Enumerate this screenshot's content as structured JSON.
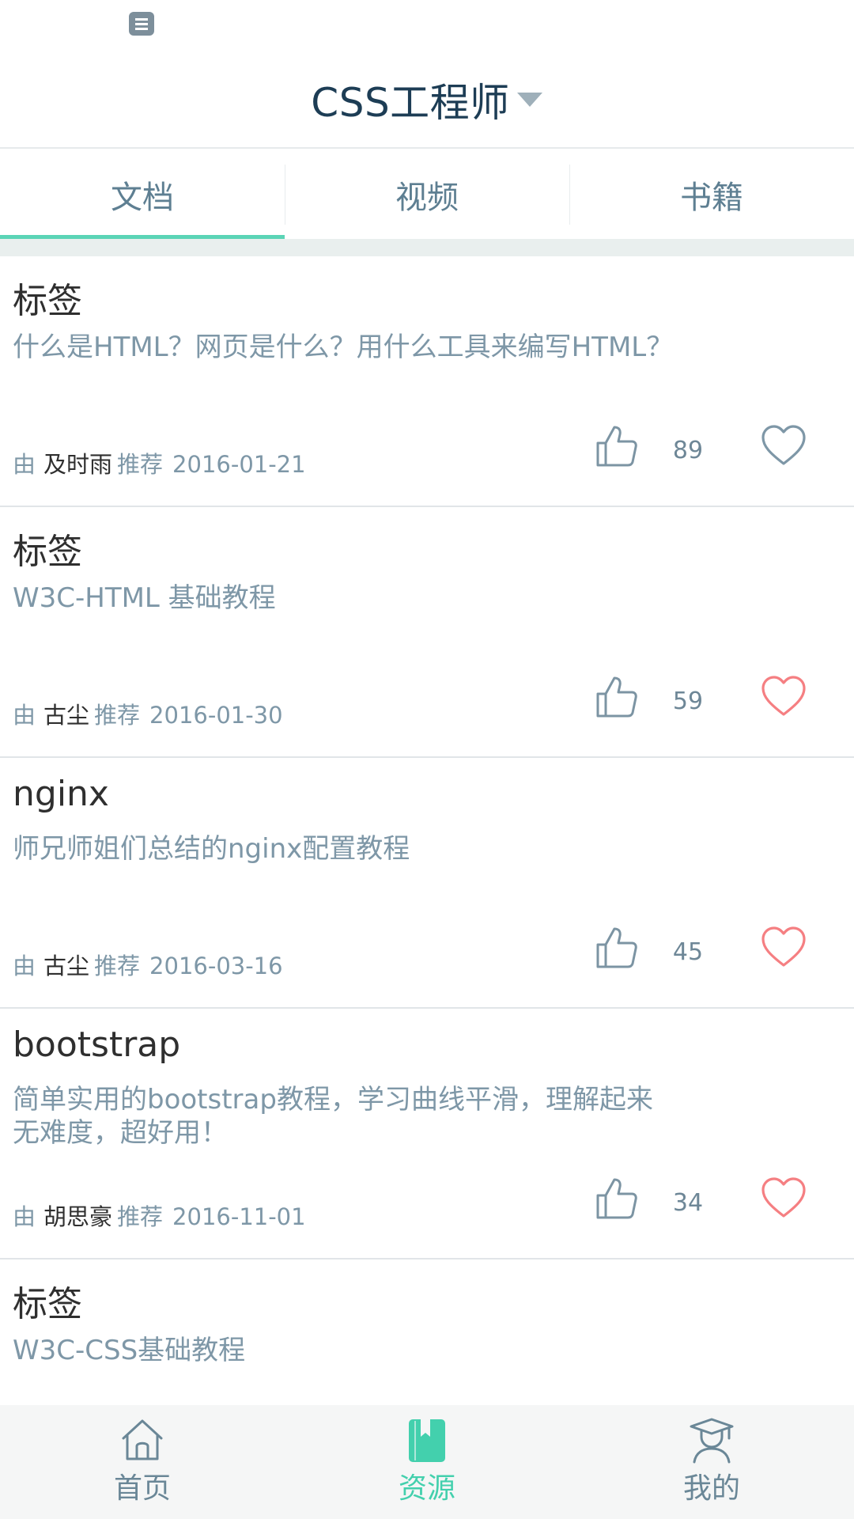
{
  "header": {
    "title": "CSS工程师"
  },
  "tabs": [
    {
      "label": "文档",
      "active": true
    },
    {
      "label": "视频",
      "active": false
    },
    {
      "label": "书籍",
      "active": false
    }
  ],
  "meta_labels": {
    "by": "由",
    "recommend": "推荐"
  },
  "cards": [
    {
      "title": "标签",
      "desc": "什么是HTML？网页是什么？用什么工具来编写HTML？",
      "author": "及时雨",
      "date": "2016-01-21",
      "likes": "89",
      "favorited": false
    },
    {
      "title": "标签",
      "desc": "W3C-HTML 基础教程",
      "author": "古尘",
      "date": "2016-01-30",
      "likes": "59",
      "favorited": true
    },
    {
      "title": "nginx",
      "desc": "师兄师姐们总结的nginx配置教程",
      "author": "古尘",
      "date": "2016-03-16",
      "likes": "45",
      "favorited": true
    },
    {
      "title": "bootstrap",
      "desc": "简单实用的bootstrap教程，学习曲线平滑，理解起来无难度，超好用！",
      "author": "胡思豪",
      "date": "2016-11-01",
      "likes": "34",
      "favorited": true
    },
    {
      "title": "标签",
      "desc": "W3C-CSS基础教程"
    }
  ],
  "bottom_nav": [
    {
      "label": "首页",
      "icon": "home-icon",
      "active": false
    },
    {
      "label": "资源",
      "icon": "bookmark-book-icon",
      "active": true
    },
    {
      "label": "我的",
      "icon": "graduate-user-icon",
      "active": false
    }
  ],
  "colors": {
    "accent": "#43d0ad",
    "heart_active": "#f57f82",
    "heart_inactive": "#7e97a7",
    "title": "#1d3d55"
  }
}
